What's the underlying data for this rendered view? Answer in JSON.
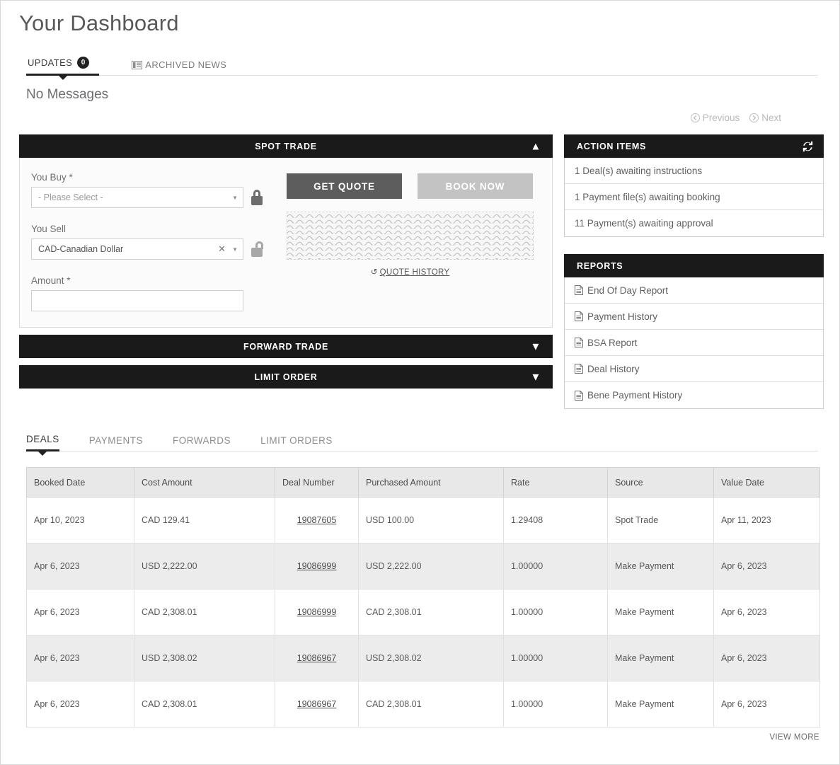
{
  "header": {
    "title": "Your Dashboard"
  },
  "top_tabs": [
    {
      "label": "UPDATES",
      "badge": "0",
      "icon": "",
      "active": true
    },
    {
      "label": "ARCHIVED NEWS",
      "badge": "",
      "icon": "newspaper-icon",
      "active": false
    }
  ],
  "messages": {
    "empty_text": "No Messages"
  },
  "pager": {
    "previous": "Previous",
    "next": "Next"
  },
  "spot_trade": {
    "title": "SPOT TRADE",
    "collapse_icon": "chevron-up-icon",
    "you_buy_label": "You Buy *",
    "you_buy_placeholder": "- Please Select -",
    "you_buy_lock": "lock-closed-icon",
    "you_sell_label": "You Sell",
    "you_sell_value": "CAD-Canadian Dollar",
    "you_sell_lock": "lock-open-icon",
    "amount_label": "Amount *",
    "amount_value": "",
    "get_quote_label": "GET QUOTE",
    "book_now_label": "BOOK NOW",
    "quote_history_label": "QUOTE HISTORY",
    "quote_history_icon": "rotate-left-icon"
  },
  "forward_trade": {
    "title": "FORWARD TRADE",
    "expand_icon": "chevron-down-icon"
  },
  "limit_order": {
    "title": "LIMIT ORDER",
    "expand_icon": "chevron-down-icon"
  },
  "action_items": {
    "title": "ACTION ITEMS",
    "refresh_icon": "refresh-icon",
    "items": [
      {
        "label": "1 Deal(s) awaiting instructions"
      },
      {
        "label": "1 Payment file(s) awaiting booking"
      },
      {
        "label": "11 Payment(s) awaiting approval"
      }
    ]
  },
  "reports": {
    "title": "REPORTS",
    "items": [
      {
        "label": "End Of Day Report",
        "icon": "document-icon"
      },
      {
        "label": "Payment History",
        "icon": "document-icon"
      },
      {
        "label": "BSA Report",
        "icon": "document-icon"
      },
      {
        "label": "Deal History",
        "icon": "document-icon"
      },
      {
        "label": "Bene Payment History",
        "icon": "document-icon"
      }
    ]
  },
  "bottom_tabs": [
    {
      "label": "DEALS",
      "active": true
    },
    {
      "label": "PAYMENTS",
      "active": false
    },
    {
      "label": "FORWARDS",
      "active": false
    },
    {
      "label": "LIMIT ORDERS",
      "active": false
    }
  ],
  "deals_table": {
    "columns": [
      "Booked Date",
      "Cost Amount",
      "Deal Number",
      "Purchased Amount",
      "Rate",
      "Source",
      "Value Date"
    ],
    "rows": [
      {
        "booked_date": "Apr 10, 2023",
        "cost_amount": "CAD 129.41",
        "deal_number": "19087605",
        "purchased_amount": "USD 100.00",
        "rate": "1.29408",
        "source": "Spot Trade",
        "value_date": "Apr 11, 2023"
      },
      {
        "booked_date": "Apr 6, 2023",
        "cost_amount": "USD 2,222.00",
        "deal_number": "19086999",
        "purchased_amount": "USD 2,222.00",
        "rate": "1.00000",
        "source": "Make Payment",
        "value_date": "Apr 6, 2023"
      },
      {
        "booked_date": "Apr 6, 2023",
        "cost_amount": "CAD 2,308.01",
        "deal_number": "19086999",
        "purchased_amount": "CAD 2,308.01",
        "rate": "1.00000",
        "source": "Make Payment",
        "value_date": "Apr 6, 2023"
      },
      {
        "booked_date": "Apr 6, 2023",
        "cost_amount": "USD 2,308.02",
        "deal_number": "19086967",
        "purchased_amount": "USD 2,308.02",
        "rate": "1.00000",
        "source": "Make Payment",
        "value_date": "Apr 6, 2023"
      },
      {
        "booked_date": "Apr 6, 2023",
        "cost_amount": "CAD 2,308.01",
        "deal_number": "19086967",
        "purchased_amount": "CAD 2,308.01",
        "rate": "1.00000",
        "source": "Make Payment",
        "value_date": "Apr 6, 2023"
      }
    ],
    "view_more_label": "VIEW MORE"
  },
  "colors": {
    "panel_header_bg": "#1a1a1a",
    "primary_button": "#5d5d5d",
    "disabled_button": "#c3c3c3",
    "row_alt_bg": "#ececec",
    "table_header_bg": "#e8e8e8"
  }
}
